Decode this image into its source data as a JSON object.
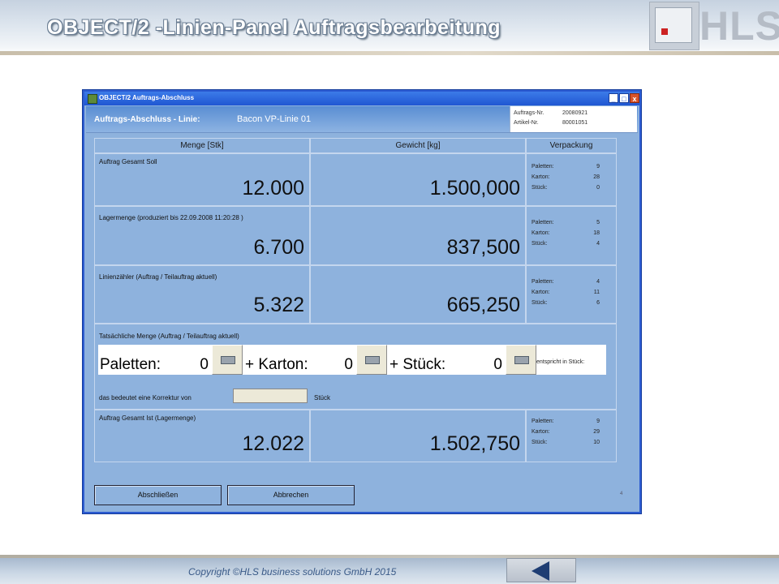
{
  "slide": {
    "title": "OBJECT/2 -Linien-Panel Auftragsbearbeitung",
    "logo_text": "HLS",
    "copyright": "Copyright ©HLS business solutions GmbH 2015"
  },
  "window": {
    "title": "OBJECT/2 Auftrags-Abschluss",
    "controls": [
      "_",
      "□",
      "x"
    ],
    "header_label": "Auftrags-Abschluss -  Linie:",
    "line_name": "Bacon VP-Linie 01",
    "info": [
      {
        "label": "Auftrags-Nr.",
        "value": "20080921"
      },
      {
        "label": "Artikel-Nr.",
        "value": "80001051"
      }
    ]
  },
  "table": {
    "columns": [
      "Menge [Stk]",
      "Gewicht [kg]",
      "Verpackung"
    ],
    "pack_labels": [
      "Paletten:",
      "Karton:",
      "Stück:"
    ],
    "rows": [
      {
        "label": "Auftrag Gesamt Soll",
        "menge": "12.000",
        "gewicht": "1.500,000",
        "pack": [
          "9",
          "28",
          "0"
        ]
      },
      {
        "label": "Lagermenge (produziert bis   22.09.2008 11:20:28    )",
        "menge": "6.700",
        "gewicht": "837,500",
        "pack": [
          "5",
          "18",
          "4"
        ]
      },
      {
        "label": "Linienzähler (Auftrag / Teilauftrag aktuell)",
        "menge": "5.322",
        "gewicht": "665,250",
        "pack": [
          "4",
          "11",
          "6"
        ]
      }
    ],
    "actual": {
      "label": "Tatsächliche Menge (Auftrag / Teilauftrag aktuell)",
      "paletten_label": "Paletten:",
      "paletten_value": "0",
      "karton_label": "+ Karton:",
      "karton_value": "0",
      "stueck_label": "+ Stück:",
      "stueck_value": "0",
      "entspricht": "entspricht in Stück:",
      "correction_label": "das bedeutet eine Korrektur von",
      "correction_value": "",
      "correction_unit": "Stück"
    },
    "total": {
      "label": "Auftrag Gesamt Ist (Lagermenge)",
      "menge": "12.022",
      "gewicht": "1.502,750",
      "pack": [
        "9",
        "29",
        "10"
      ]
    }
  },
  "buttons": {
    "abschliessen": "Abschließen",
    "abbrechen": "Abbrechen"
  },
  "corner_number": "4",
  "icons": [
    "keyboard-icon",
    "back-arrow-icon",
    "window-icon"
  ]
}
